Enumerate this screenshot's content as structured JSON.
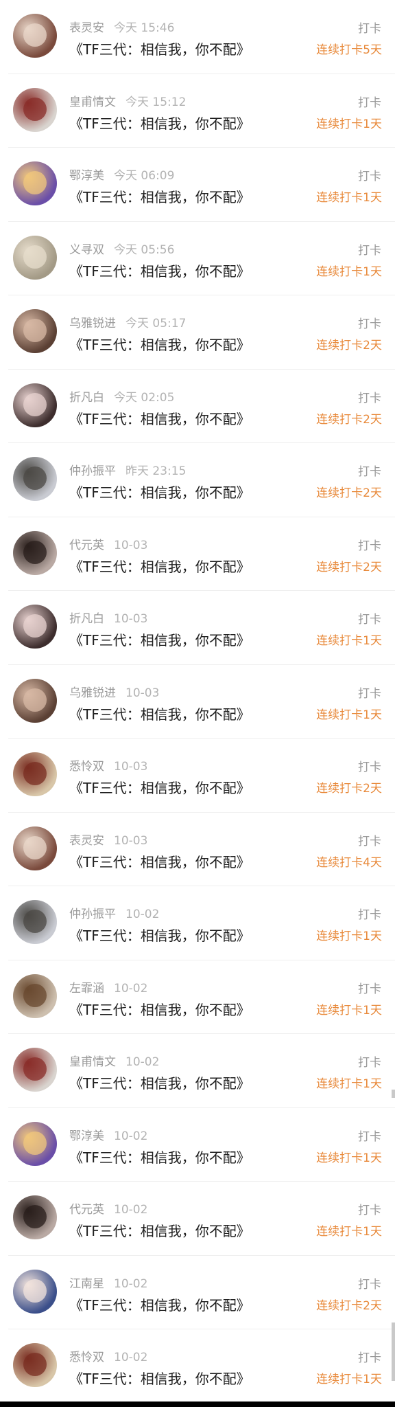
{
  "items": [
    {
      "name": "表灵安",
      "time": "今天 15:46",
      "book": "《TF三代：相信我，你不配》",
      "type": "打卡",
      "streak": "连续打卡5天",
      "avatar": {
        "bg": "#7a4a3c",
        "accent": "#e8d6c8"
      }
    },
    {
      "name": "皇甫情文",
      "time": "今天 15:12",
      "book": "《TF三代：相信我，你不配》",
      "type": "打卡",
      "streak": "连续打卡1天",
      "avatar": {
        "bg": "#d9d4cf",
        "accent": "#8a2e2a"
      }
    },
    {
      "name": "鄂淳美",
      "time": "今天 06:09",
      "book": "《TF三代：相信我，你不配》",
      "type": "打卡",
      "streak": "连续打卡1天",
      "avatar": {
        "bg": "#6a4ea8",
        "accent": "#f0c77c"
      }
    },
    {
      "name": "义寻双",
      "time": "今天 05:56",
      "book": "《TF三代：相信我，你不配》",
      "type": "打卡",
      "streak": "连续打卡1天",
      "avatar": {
        "bg": "#a39a86",
        "accent": "#e6dccb"
      }
    },
    {
      "name": "乌雅锐进",
      "time": "今天 05:17",
      "book": "《TF三代：相信我，你不配》",
      "type": "打卡",
      "streak": "连续打卡2天",
      "avatar": {
        "bg": "#5b4034",
        "accent": "#d7b8a4"
      }
    },
    {
      "name": "折凡白",
      "time": "今天 02:05",
      "book": "《TF三代：相信我，你不配》",
      "type": "打卡",
      "streak": "连续打卡2天",
      "avatar": {
        "bg": "#3d2d2d",
        "accent": "#e7d1cf"
      }
    },
    {
      "name": "仲孙振平",
      "time": "昨天 23:15",
      "book": "《TF三代：相信我，你不配》",
      "type": "打卡",
      "streak": "连续打卡2天",
      "avatar": {
        "bg": "#c9cbd2",
        "accent": "#4c4a46"
      }
    },
    {
      "name": "代元英",
      "time": "10-03",
      "book": "《TF三代：相信我，你不配》",
      "type": "打卡",
      "streak": "连续打卡2天",
      "avatar": {
        "bg": "#b9a9a3",
        "accent": "#2a1f1c"
      }
    },
    {
      "name": "折凡白",
      "time": "10-03",
      "book": "《TF三代：相信我，你不配》",
      "type": "打卡",
      "streak": "连续打卡1天",
      "avatar": {
        "bg": "#3d2d2d",
        "accent": "#e7d1cf"
      }
    },
    {
      "name": "乌雅锐进",
      "time": "10-03",
      "book": "《TF三代：相信我，你不配》",
      "type": "打卡",
      "streak": "连续打卡1天",
      "avatar": {
        "bg": "#5b4034",
        "accent": "#d7b8a4"
      }
    },
    {
      "name": "悉怜双",
      "time": "10-03",
      "book": "《TF三代：相信我，你不配》",
      "type": "打卡",
      "streak": "连续打卡2天",
      "avatar": {
        "bg": "#d8c6a8",
        "accent": "#7a2e22"
      }
    },
    {
      "name": "表灵安",
      "time": "10-03",
      "book": "《TF三代：相信我，你不配》",
      "type": "打卡",
      "streak": "连续打卡4天",
      "avatar": {
        "bg": "#7a4a3c",
        "accent": "#e8d6c8"
      }
    },
    {
      "name": "仲孙振平",
      "time": "10-02",
      "book": "《TF三代：相信我，你不配》",
      "type": "打卡",
      "streak": "连续打卡1天",
      "avatar": {
        "bg": "#c9cbd2",
        "accent": "#4c4a46"
      }
    },
    {
      "name": "左霏涵",
      "time": "10-02",
      "book": "《TF三代：相信我，你不配》",
      "type": "打卡",
      "streak": "连续打卡1天",
      "avatar": {
        "bg": "#cdbfae",
        "accent": "#6a4a30"
      }
    },
    {
      "name": "皇甫情文",
      "time": "10-02",
      "book": "《TF三代：相信我，你不配》",
      "type": "打卡",
      "streak": "连续打卡1天",
      "avatar": {
        "bg": "#d9d4cf",
        "accent": "#8a2e2a"
      }
    },
    {
      "name": "鄂淳美",
      "time": "10-02",
      "book": "《TF三代：相信我，你不配》",
      "type": "打卡",
      "streak": "连续打卡1天",
      "avatar": {
        "bg": "#6a4ea8",
        "accent": "#f0c77c"
      }
    },
    {
      "name": "代元英",
      "time": "10-02",
      "book": "《TF三代：相信我，你不配》",
      "type": "打卡",
      "streak": "连续打卡1天",
      "avatar": {
        "bg": "#b9a9a3",
        "accent": "#2a1f1c"
      }
    },
    {
      "name": "江南星",
      "time": "10-02",
      "book": "《TF三代：相信我，你不配》",
      "type": "打卡",
      "streak": "连续打卡2天",
      "avatar": {
        "bg": "#3b4f8a",
        "accent": "#f2e3dc"
      }
    },
    {
      "name": "悉怜双",
      "time": "10-02",
      "book": "《TF三代：相信我，你不配》",
      "type": "打卡",
      "streak": "连续打卡1天",
      "avatar": {
        "bg": "#d8c6a8",
        "accent": "#7a2e22"
      }
    }
  ],
  "colors": {
    "streak": "#e8893a",
    "muted": "#9a9a9a",
    "text": "#1f1f1f"
  }
}
